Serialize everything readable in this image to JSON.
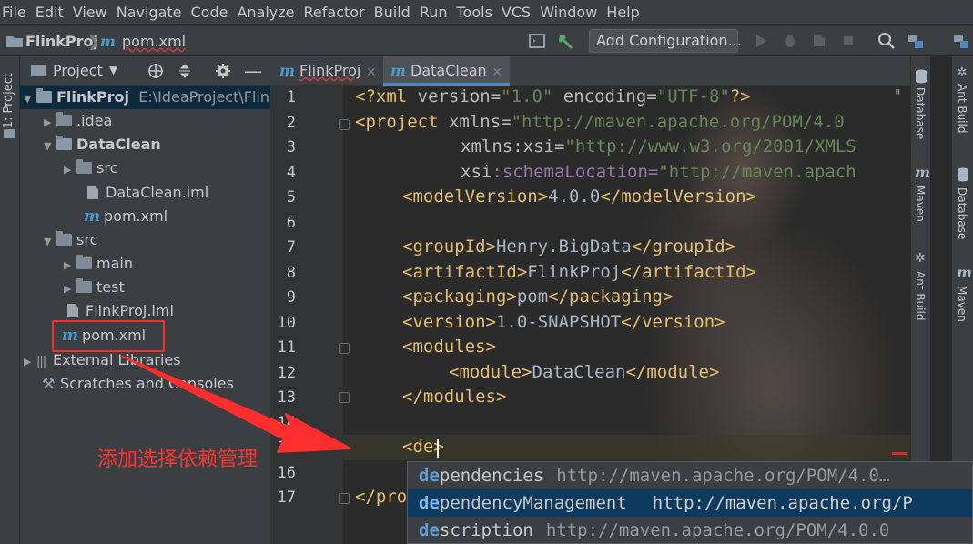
{
  "menu": [
    "File",
    "Edit",
    "View",
    "Navigate",
    "Code",
    "Analyze",
    "Refactor",
    "Build",
    "Run",
    "Tools",
    "VCS",
    "Window",
    "Help"
  ],
  "navbar": {
    "project_crumb": "FlinkProj",
    "file_crumb": "pom.xml",
    "add_configuration": "Add Configuration..."
  },
  "left_stripe": {
    "label": "1: Project"
  },
  "project_panel": {
    "title": "Project",
    "tree": [
      {
        "label": "FlinkProj",
        "extra": "E:\\IdeaProject\\FlinkPr"
      },
      {
        "label": ".idea"
      },
      {
        "label": "DataClean"
      },
      {
        "label": "src"
      },
      {
        "label": "DataClean.iml"
      },
      {
        "label": "pom.xml"
      },
      {
        "label": "src"
      },
      {
        "label": "main"
      },
      {
        "label": "test"
      },
      {
        "label": "FlinkProj.iml"
      },
      {
        "label": "pom.xml"
      },
      {
        "label": "External Libraries"
      },
      {
        "label": "Scratches and Consoles"
      }
    ]
  },
  "tabs": [
    {
      "label": "FlinkProj",
      "close": "×"
    },
    {
      "label": "DataClean",
      "close": "×"
    }
  ],
  "editor": {
    "line_numbers": [
      "1",
      "2",
      "3",
      "4",
      "5",
      "6",
      "7",
      "8",
      "9",
      "10",
      "11",
      "12",
      "13",
      "14",
      "15",
      "16",
      "17"
    ],
    "lines": {
      "l1_a": "<?xml ",
      "l1_b": "version=",
      "l1_c": "\"1.0\"",
      "l1_d": " encoding=",
      "l1_e": "\"UTF-8\"",
      "l1_f": "?>",
      "l2_a": "<project ",
      "l2_b": "xmlns=",
      "l2_c": "\"http://maven.apache.org/POM/4.0",
      "l3_a": "xmlns",
      "l3_b": ":xsi=",
      "l3_c": "\"http://www.w3.org/2001/XMLS",
      "l4_a": "xsi",
      "l4_b": ":schemaLocation=",
      "l4_c": "\"http://maven.apach",
      "l5_open": "<modelVersion>",
      "l5_val": "4.0.0",
      "l5_close": "</modelVersion>",
      "l7_open": "<groupId>",
      "l7_val": "Henry.BigData",
      "l7_close": "</groupId>",
      "l8_open": "<artifactId>",
      "l8_val": "FlinkProj",
      "l8_close": "</artifactId>",
      "l9_open": "<packaging>",
      "l9_val": "pom",
      "l9_close": "</packaging>",
      "l10_open": "<version>",
      "l10_val": "1.0-SNAPSHOT",
      "l10_close": "</version>",
      "l11": "<modules>",
      "l12_open": "<module>",
      "l12_val": "DataClean",
      "l12_close": "</module>",
      "l13": "</modules>",
      "l15": "<de>",
      "l17": "</pro"
    }
  },
  "completion": [
    {
      "match": "de",
      "rest": "pendencies",
      "url": "http://maven.apache.org/POM/4.0…"
    },
    {
      "match": "de",
      "rest": "pendencyManagement",
      "url": "http://maven.apache.org/P"
    },
    {
      "match": "de",
      "rest": "scription",
      "url": "http://maven.apache.org/POM/4.0.0"
    }
  ],
  "right_tools": {
    "database": "Database",
    "maven": "Maven",
    "ant_build": "Ant Build"
  },
  "annotation": "添加选择依赖管理",
  "colors": {
    "annotation": "#ff3333",
    "selection": "#0d3a5f",
    "tag": "#e8bf6a",
    "string": "#6a8759"
  }
}
